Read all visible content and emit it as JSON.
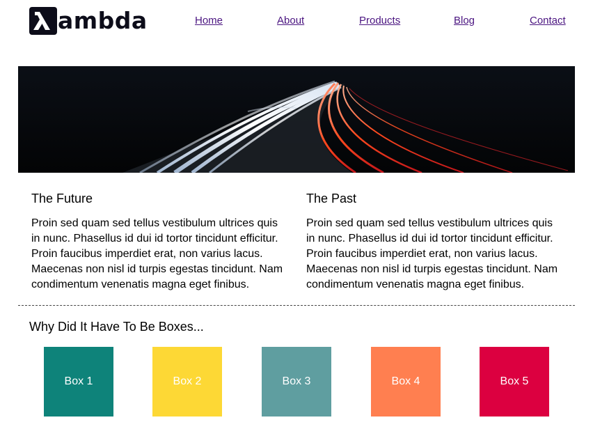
{
  "logo": {
    "text": "ambda"
  },
  "nav": [
    {
      "label": "Home"
    },
    {
      "label": "About"
    },
    {
      "label": "Products"
    },
    {
      "label": "Blog"
    },
    {
      "label": "Contact"
    }
  ],
  "sections": [
    {
      "title": "The Future",
      "body": "Proin sed quam sed tellus vestibulum ultrices quis in nunc. Phasellus id dui id tortor tincidunt efficitur. Proin faucibus imperdiet erat, non varius lacus. Maecenas non nisl id turpis egestas tincidunt. Nam condimentum venenatis magna eget finibus."
    },
    {
      "title": "The Past",
      "body": "Proin sed quam sed tellus vestibulum ultrices quis in nunc. Phasellus id dui id tortor tincidunt efficitur. Proin faucibus imperdiet erat, non varius lacus. Maecenas non nisl id turpis egestas tincidunt. Nam condimentum venenatis magna eget finibus."
    }
  ],
  "boxes_section": {
    "title": "Why Did It Have To Be Boxes...",
    "boxes": [
      {
        "label": "Box 1",
        "color": "#0e837a"
      },
      {
        "label": "Box 2",
        "color": "#fdd835"
      },
      {
        "label": "Box 3",
        "color": "#5f9ea0"
      },
      {
        "label": "Box 4",
        "color": "#ff7f50"
      },
      {
        "label": "Box 5",
        "color": "#dc0040"
      }
    ]
  }
}
